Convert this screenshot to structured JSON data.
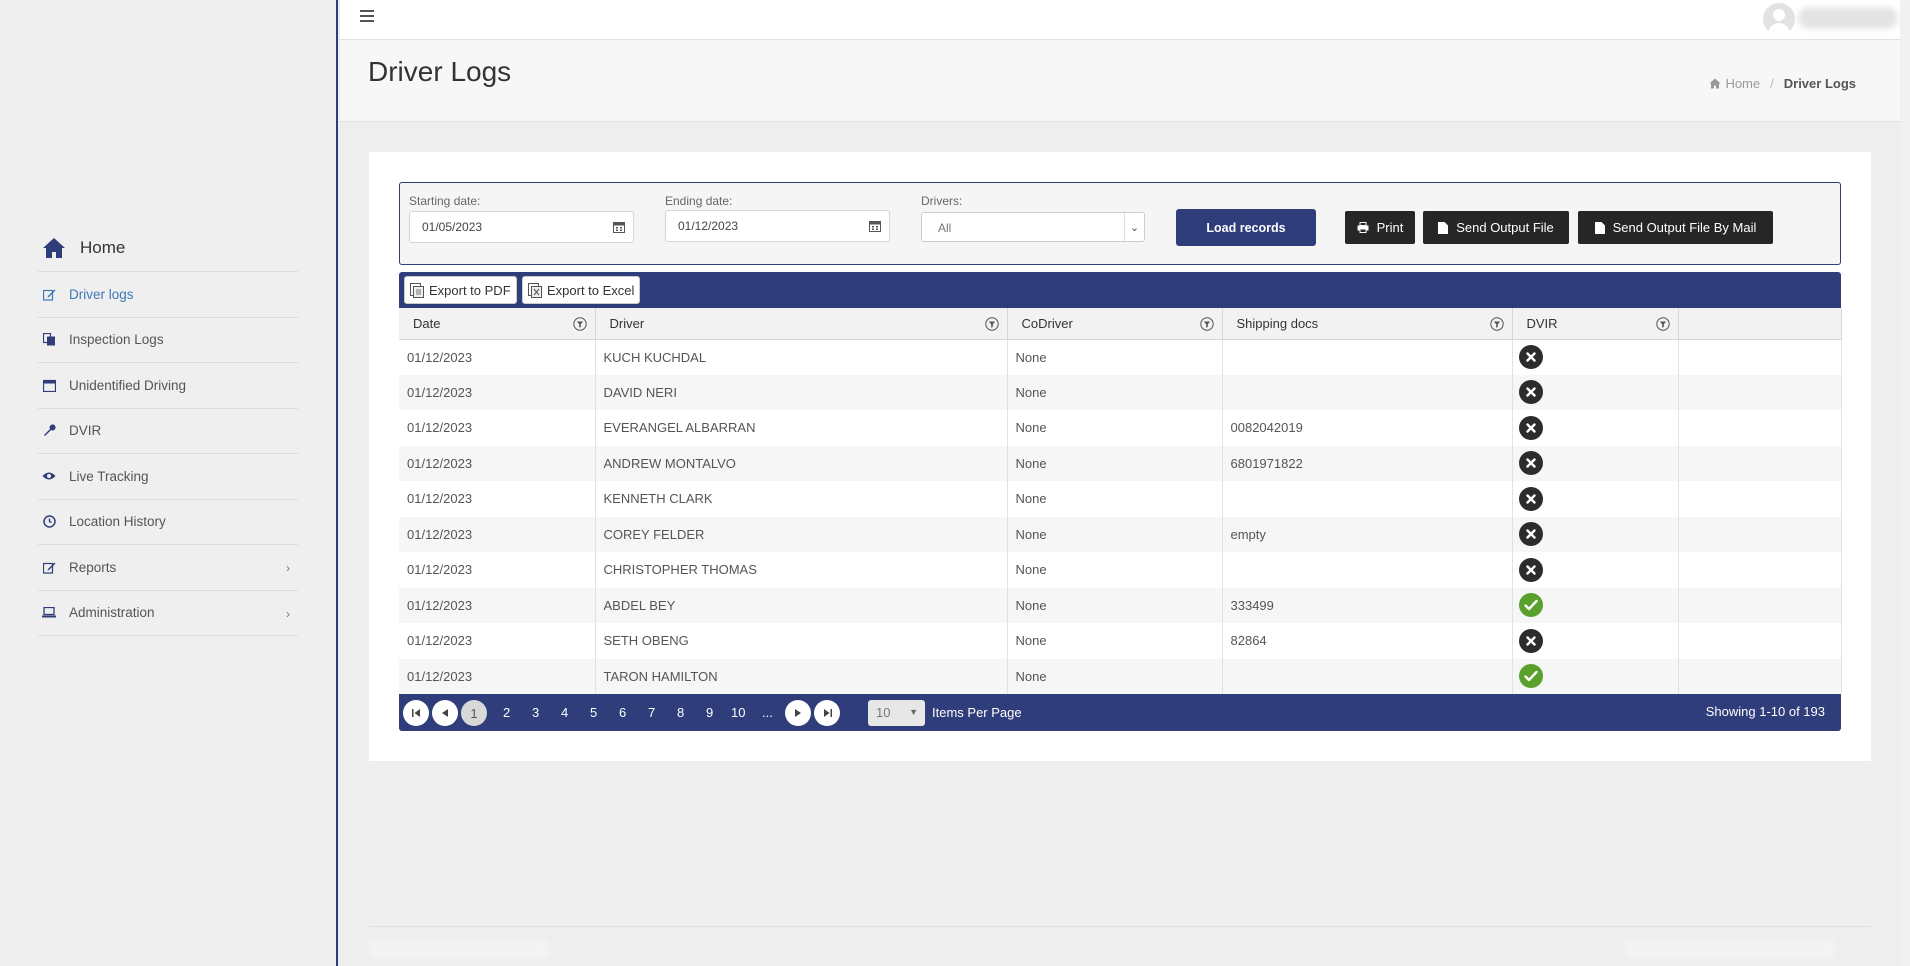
{
  "sidebar": {
    "home_label": "Home",
    "items": [
      {
        "label": "Driver logs",
        "icon": "edit-icon",
        "active": true
      },
      {
        "label": "Inspection Logs",
        "icon": "copy-icon"
      },
      {
        "label": "Unidentified Driving",
        "icon": "calendar-icon"
      },
      {
        "label": "DVIR",
        "icon": "wrench-icon"
      },
      {
        "label": "Live Tracking",
        "icon": "eye-icon"
      },
      {
        "label": "Location History",
        "icon": "clock-icon"
      },
      {
        "label": "Reports",
        "icon": "edit-icon",
        "has_children": true
      },
      {
        "label": "Administration",
        "icon": "laptop-icon",
        "has_children": true
      }
    ]
  },
  "header": {
    "title": "Driver Logs",
    "breadcrumb": {
      "home": "Home",
      "current": "Driver Logs"
    }
  },
  "filters": {
    "start_label": "Starting date:",
    "start_value": "01/05/2023",
    "end_label": "Ending date:",
    "end_value": "01/12/2023",
    "drivers_label": "Drivers:",
    "drivers_value": "All",
    "load_label": "Load records",
    "print_label": "Print",
    "send_file_label": "Send Output File",
    "send_mail_label": "Send Output File By Mail"
  },
  "grid": {
    "export_pdf": "Export to PDF",
    "export_excel": "Export to Excel",
    "columns": [
      "Date",
      "Driver",
      "CoDriver",
      "Shipping docs",
      "DVIR"
    ],
    "rows": [
      {
        "date": "01/12/2023",
        "driver": "KUCH KUCHDAL",
        "codriver": "None",
        "shipping": "",
        "dvir": "no"
      },
      {
        "date": "01/12/2023",
        "driver": "DAVID NERI",
        "codriver": "None",
        "shipping": "",
        "dvir": "no"
      },
      {
        "date": "01/12/2023",
        "driver": "EVERANGEL ALBARRAN",
        "codriver": "None",
        "shipping": "0082042019",
        "dvir": "no"
      },
      {
        "date": "01/12/2023",
        "driver": "ANDREW MONTALVO",
        "codriver": "None",
        "shipping": "6801971822",
        "dvir": "no"
      },
      {
        "date": "01/12/2023",
        "driver": "KENNETH CLARK",
        "codriver": "None",
        "shipping": "",
        "dvir": "no"
      },
      {
        "date": "01/12/2023",
        "driver": "COREY FELDER",
        "codriver": "None",
        "shipping": "empty",
        "dvir": "no"
      },
      {
        "date": "01/12/2023",
        "driver": "CHRISTOPHER THOMAS",
        "codriver": "None",
        "shipping": "",
        "dvir": "no"
      },
      {
        "date": "01/12/2023",
        "driver": "ABDEL BEY",
        "codriver": "None",
        "shipping": "333499",
        "dvir": "yes"
      },
      {
        "date": "01/12/2023",
        "driver": "SETH OBENG",
        "codriver": "None",
        "shipping": "82864",
        "dvir": "no"
      },
      {
        "date": "01/12/2023",
        "driver": "TARON HAMILTON",
        "codriver": "None",
        "shipping": "",
        "dvir": "yes"
      }
    ],
    "pager": {
      "current_page": "1",
      "pages": [
        "2",
        "3",
        "4",
        "5",
        "6",
        "7",
        "8",
        "9",
        "10",
        "..."
      ],
      "page_size": "10",
      "items_per_page_label": "Items Per Page",
      "info": "Showing 1-10 of 193"
    }
  },
  "colors": {
    "accent": "#2f3d7a",
    "active_link": "#3c78b4",
    "dvir_pass": "#5aa02c",
    "dvir_fail": "#2c2c2c"
  }
}
